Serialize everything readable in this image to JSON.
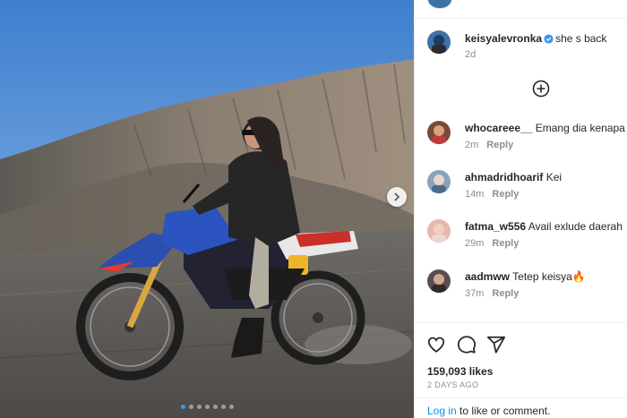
{
  "post": {
    "author": "keisyalevronka",
    "caption": "she s back",
    "caption_age": "2d",
    "verified_icon": "verified-badge-icon",
    "accent_color": "#3897f0",
    "carousel_total": 7,
    "carousel_active": 1
  },
  "comments": [
    {
      "user": "whocareee__",
      "text": "Emang dia kenapa",
      "age": "2m",
      "reply": "Reply"
    },
    {
      "user": "ahmadridhoarif",
      "text": "Kei",
      "age": "14m",
      "reply": "Reply"
    },
    {
      "user": "fatma_w556",
      "text": "Avail exlude daerah",
      "age": "29m",
      "reply": "Reply"
    },
    {
      "user": "aadmww",
      "text": "Tetep keisya🔥",
      "age": "37m",
      "reply": "Reply"
    }
  ],
  "stats": {
    "likes": "159,093 likes",
    "date": "2 DAYS AGO"
  },
  "footer": {
    "login_link": "Log in",
    "login_text": " to like or comment."
  },
  "icons": {
    "load_more": "plus-circle-icon",
    "like": "heart-icon",
    "comment": "comment-bubble-icon",
    "share": "send-arrow-icon",
    "next": "chevron-right-icon"
  }
}
